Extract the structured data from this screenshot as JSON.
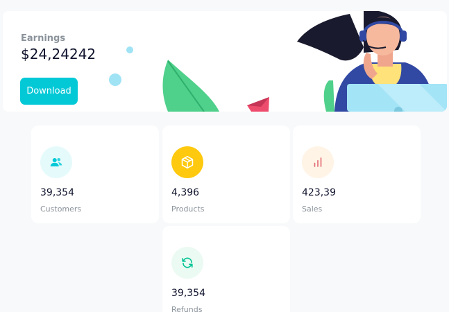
{
  "earnings": {
    "label": "Earnings",
    "amount": "$24,24242",
    "download_label": "Download"
  },
  "stats": [
    {
      "value": "39,354",
      "label": "Customers",
      "icon": "customers-icon",
      "icon_color": "#03c9d7",
      "icon_bg": "#e5fafb"
    },
    {
      "value": "4,396",
      "label": "Products",
      "icon": "box-icon",
      "icon_color": "#ffffff",
      "icon_bg": "#fec90f"
    },
    {
      "value": "423,39",
      "label": "Sales",
      "icon": "bar-chart-icon",
      "icon_color": "#e46a76",
      "icon_bg": "#fff4e5"
    },
    {
      "value": "39,354",
      "label": "Refunds",
      "icon": "refresh-icon",
      "icon_color": "#00c292",
      "icon_bg": "#ebfaf2"
    }
  ],
  "colors": {
    "accent": "#03c9d7",
    "background": "#f8f9fa",
    "card": "#ffffff"
  }
}
